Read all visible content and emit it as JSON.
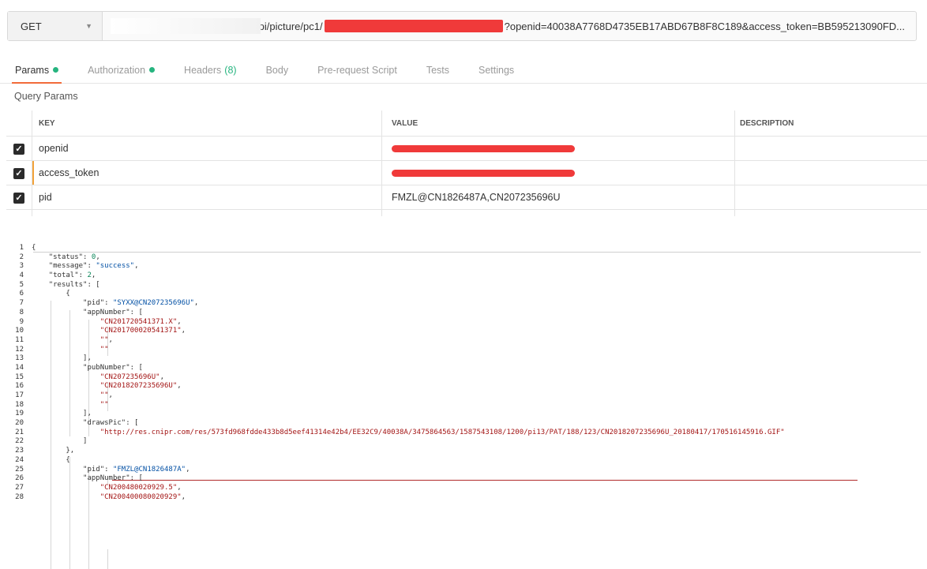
{
  "request": {
    "method": "GET",
    "url_visible_prefix": "/v1/api/picture/pc1/",
    "url_visible_suffix": "?openid=40038A7768D4735EB17ABD67B8F8C189&access_token=BB595213090FD..."
  },
  "tabs": [
    {
      "label": "Params",
      "dot": true,
      "active": true
    },
    {
      "label": "Authorization",
      "dot": true,
      "active": false
    },
    {
      "label": "Headers",
      "count": "(8)",
      "active": false
    },
    {
      "label": "Body",
      "active": false
    },
    {
      "label": "Pre-request Script",
      "active": false
    },
    {
      "label": "Tests",
      "active": false
    },
    {
      "label": "Settings",
      "active": false
    }
  ],
  "query_params": {
    "title": "Query Params",
    "headers": {
      "key": "KEY",
      "value": "VALUE",
      "description": "DESCRIPTION"
    },
    "rows": [
      {
        "key": "openid",
        "value": "",
        "redacted": true
      },
      {
        "key": "access_token",
        "value": "",
        "redacted": true
      },
      {
        "key": "pid",
        "value": "FMZL@CN1826487A,CN207235696U",
        "redacted": false
      }
    ]
  },
  "response": {
    "line_numbers": [
      "1",
      "2",
      "3",
      "4",
      "5",
      "6",
      "7",
      "8",
      "9",
      "10",
      "11",
      "12",
      "13",
      "14",
      "15",
      "16",
      "17",
      "18",
      "19",
      "20",
      "21",
      "22",
      "23",
      "24",
      "25",
      "26",
      "27",
      "28"
    ],
    "status": "0",
    "message": "\"success\"",
    "total": "2",
    "r1_pid": "\"SYXX@CN207235696U\"",
    "r1_app1": "\"CN201720541371.X\"",
    "r1_app2": "\"CN201700020541371\"",
    "r1_pub1": "\"CN207235696U\"",
    "r1_pub2": "\"CN2018207235696U\"",
    "r1_pic": "\"http://res.cnipr.com/res/573fd968fdde433b8d5eef41314e42b4/EE32C9/40038A/3475864563/1587543108/1200/pi13/PAT/188/123/CN2018207235696U_20180417/170516145916.GIF\"",
    "r2_pid": "\"FMZL@CN1826487A\"",
    "r2_app1": "\"CN200480020929.5\"",
    "r2_app2": "\"CN200400080020929\""
  }
}
